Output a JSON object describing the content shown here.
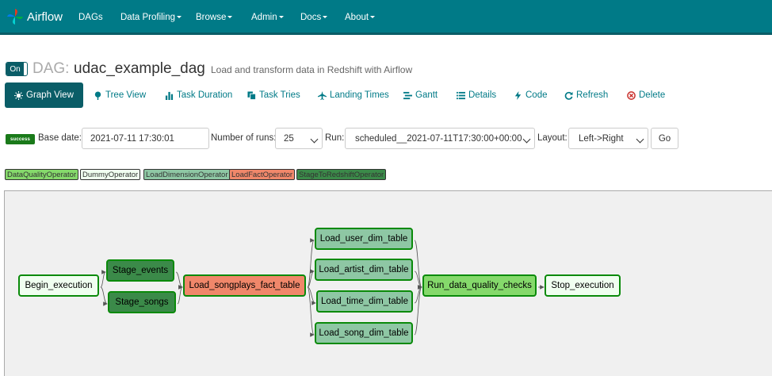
{
  "navbar": {
    "brand": "Airflow",
    "items": [
      "DAGs",
      "Data Profiling",
      "Browse",
      "Admin",
      "Docs",
      "About"
    ]
  },
  "dag": {
    "toggle": "On",
    "label": "DAG:",
    "id": "udac_example_dag",
    "description": "Load and transform data in Redshift with Airflow"
  },
  "tabs": [
    "Graph View",
    "Tree View",
    "Task Duration",
    "Task Tries",
    "Landing Times",
    "Gantt",
    "Details",
    "Code",
    "Refresh",
    "Delete"
  ],
  "form": {
    "state": "success",
    "base_date_label": "Base date:",
    "base_date": "2021-07-11 17:30:01",
    "num_runs_label": "Number of runs:",
    "num_runs": "25",
    "run_label": "Run:",
    "run": "scheduled__2021-07-11T17:30:00+00:00",
    "layout_label": "Layout:",
    "layout": "Left->Right",
    "go": "Go"
  },
  "legend": [
    {
      "name": "DataQualityOperator",
      "color": "#85d96b"
    },
    {
      "name": "DummyOperator",
      "color": "#f0fff0"
    },
    {
      "name": "LoadDimensionOperator",
      "color": "#8ec7a4"
    },
    {
      "name": "LoadFactOperator",
      "color": "#f0876a"
    },
    {
      "name": "StageToRedshiftOperator",
      "color": "#3b8a49"
    }
  ],
  "tasks": [
    {
      "name": "Begin_execution",
      "color": "#f0fff0"
    },
    {
      "name": "Stage_events",
      "color": "#3b8a49"
    },
    {
      "name": "Stage_songs",
      "color": "#3b8a49"
    },
    {
      "name": "Load_songplays_fact_table",
      "color": "#f0876a"
    },
    {
      "name": "Load_user_dim_table",
      "color": "#8ec7a4"
    },
    {
      "name": "Load_artist_dim_table",
      "color": "#8ec7a4"
    },
    {
      "name": "Load_time_dim_table",
      "color": "#8ec7a4"
    },
    {
      "name": "Load_song_dim_table",
      "color": "#8ec7a4"
    },
    {
      "name": "Run_data_quality_checks",
      "color": "#85d96b"
    },
    {
      "name": "Stop_execution",
      "color": "#f0fff0"
    }
  ],
  "edges": [
    [
      "Begin_execution",
      "Stage_events"
    ],
    [
      "Begin_execution",
      "Stage_songs"
    ],
    [
      "Stage_events",
      "Load_songplays_fact_table"
    ],
    [
      "Stage_songs",
      "Load_songplays_fact_table"
    ],
    [
      "Load_songplays_fact_table",
      "Load_user_dim_table"
    ],
    [
      "Load_songplays_fact_table",
      "Load_artist_dim_table"
    ],
    [
      "Load_songplays_fact_table",
      "Load_time_dim_table"
    ],
    [
      "Load_songplays_fact_table",
      "Load_song_dim_table"
    ],
    [
      "Load_user_dim_table",
      "Run_data_quality_checks"
    ],
    [
      "Load_artist_dim_table",
      "Run_data_quality_checks"
    ],
    [
      "Load_time_dim_table",
      "Run_data_quality_checks"
    ],
    [
      "Load_song_dim_table",
      "Run_data_quality_checks"
    ],
    [
      "Run_data_quality_checks",
      "Stop_execution"
    ]
  ]
}
